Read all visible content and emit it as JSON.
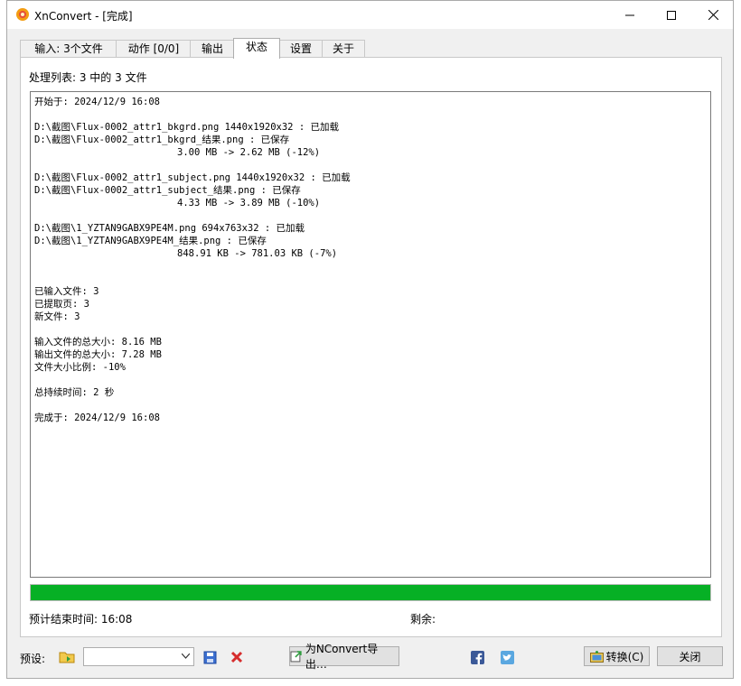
{
  "window": {
    "title": "XnConvert - [完成]"
  },
  "tabs": [
    {
      "label": "输入: 3个文件"
    },
    {
      "label": "动作 [0/0]"
    },
    {
      "label": "输出"
    },
    {
      "label": "状态"
    },
    {
      "label": "设置"
    },
    {
      "label": "关于"
    }
  ],
  "status": {
    "count_label": "处理列表: 3 中的 3 文件",
    "log_lines": [
      "开始于: 2024/12/9 16:08",
      "",
      "D:\\截图\\Flux-0002_attr1_bkgrd.png 1440x1920x32 : 已加载",
      "D:\\截图\\Flux-0002_attr1_bkgrd_结果.png : 已保存",
      "                         3.00 MB -> 2.62 MB (-12%)",
      "",
      "D:\\截图\\Flux-0002_attr1_subject.png 1440x1920x32 : 已加载",
      "D:\\截图\\Flux-0002_attr1_subject_结果.png : 已保存",
      "                         4.33 MB -> 3.89 MB (-10%)",
      "",
      "D:\\截图\\1_YZTAN9GABX9PE4M.png 694x763x32 : 已加载",
      "D:\\截图\\1_YZTAN9GABX9PE4M_结果.png : 已保存",
      "                         848.91 KB -> 781.03 KB (-7%)",
      "",
      "",
      "已输入文件: 3",
      "已提取页: 3",
      "新文件: 3",
      "",
      "输入文件的总大小: 8.16 MB",
      "输出文件的总大小: 7.28 MB",
      "文件大小比例: -10%",
      "",
      "总持续时间: 2 秒",
      "",
      "完成于: 2024/12/9 16:08"
    ],
    "progress_percent": 100,
    "eta_label": "预计结束时间: 16:08",
    "remaining_label": "剩余:"
  },
  "bottom": {
    "preset_label": "预设:",
    "preset_value": "",
    "export_label": "为NConvert导出…",
    "convert_label": "转换(C)",
    "close_label": "关闭"
  },
  "colors": {
    "progress": "#06b025",
    "accent": "#0078d7"
  }
}
